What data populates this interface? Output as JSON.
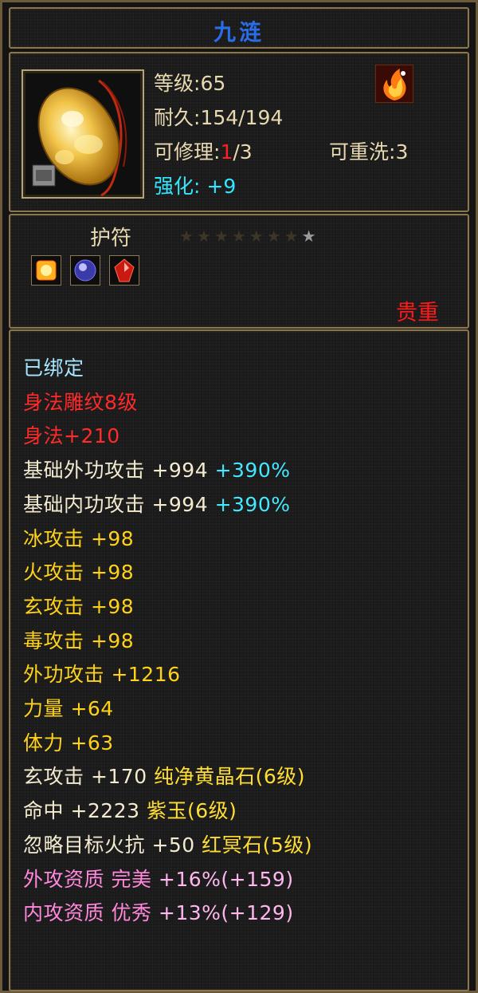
{
  "title": "九涟",
  "colors": {
    "title": "#2a6de8",
    "border": "#8a7750",
    "bound": "#a7e6ff",
    "red": "#ff2a2a",
    "cyan": "#44e8ff",
    "yellow": "#ffd21a",
    "pink": "#ff88dd"
  },
  "item": {
    "icon": "amber-jade-pendant-icon",
    "badge_icon": "fire-phoenix-icon"
  },
  "stats": {
    "level_label": "等级",
    "level_value": ":65",
    "durability_label": "耐久",
    "durability_value": ":154/194",
    "repair_label": "可修理:",
    "repair_current": "1",
    "repair_total": "/3",
    "reroll_label": "可重洗",
    "reroll_value": ":3",
    "enhance_label": "强化:",
    "enhance_value": "+9"
  },
  "amulet": {
    "label": "护符",
    "stars_total": 8,
    "stars_lit": 1,
    "gems": [
      "gold-gem-icon",
      "blue-gem-icon",
      "red-gem-icon"
    ],
    "rarity": "贵重"
  },
  "attributes": [
    {
      "text": "已绑定",
      "color": "bound"
    },
    {
      "text": "身法雕纹8级",
      "color": "red"
    },
    {
      "text": "身法+210",
      "color": "red"
    },
    {
      "text": "基础外功攻击 +994",
      "extra": "+390%",
      "color": "white",
      "extra_color": "cyan"
    },
    {
      "text": "基础内功攻击 +994",
      "extra": "+390%",
      "color": "white",
      "extra_color": "cyan"
    },
    {
      "text": "冰攻击 +98",
      "color": "yellow"
    },
    {
      "text": "火攻击 +98",
      "color": "yellow"
    },
    {
      "text": "玄攻击 +98",
      "color": "yellow"
    },
    {
      "text": "毒攻击 +98",
      "color": "yellow"
    },
    {
      "text": "外功攻击 +1216",
      "color": "yellow"
    },
    {
      "text": "力量 +64",
      "color": "yellow"
    },
    {
      "text": "体力 +63",
      "color": "yellow"
    },
    {
      "text": "玄攻击 +170",
      "extra": "纯净黄晶石(6级)",
      "color": "white",
      "extra_color": "gold"
    },
    {
      "text": "命中 +2223",
      "extra": "紫玉(6级)",
      "color": "white",
      "extra_color": "gold"
    },
    {
      "text": "忽略目标火抗 +50",
      "extra": "红冥石(5级)",
      "color": "white",
      "extra_color": "gold"
    },
    {
      "text": "外攻资质  完美",
      "extra": "+16%(+159)",
      "color": "pink",
      "extra_color": "lightpink"
    },
    {
      "text": "内攻资质  优秀",
      "extra": "+13%(+129)",
      "color": "pink",
      "extra_color": "lightpink"
    }
  ]
}
